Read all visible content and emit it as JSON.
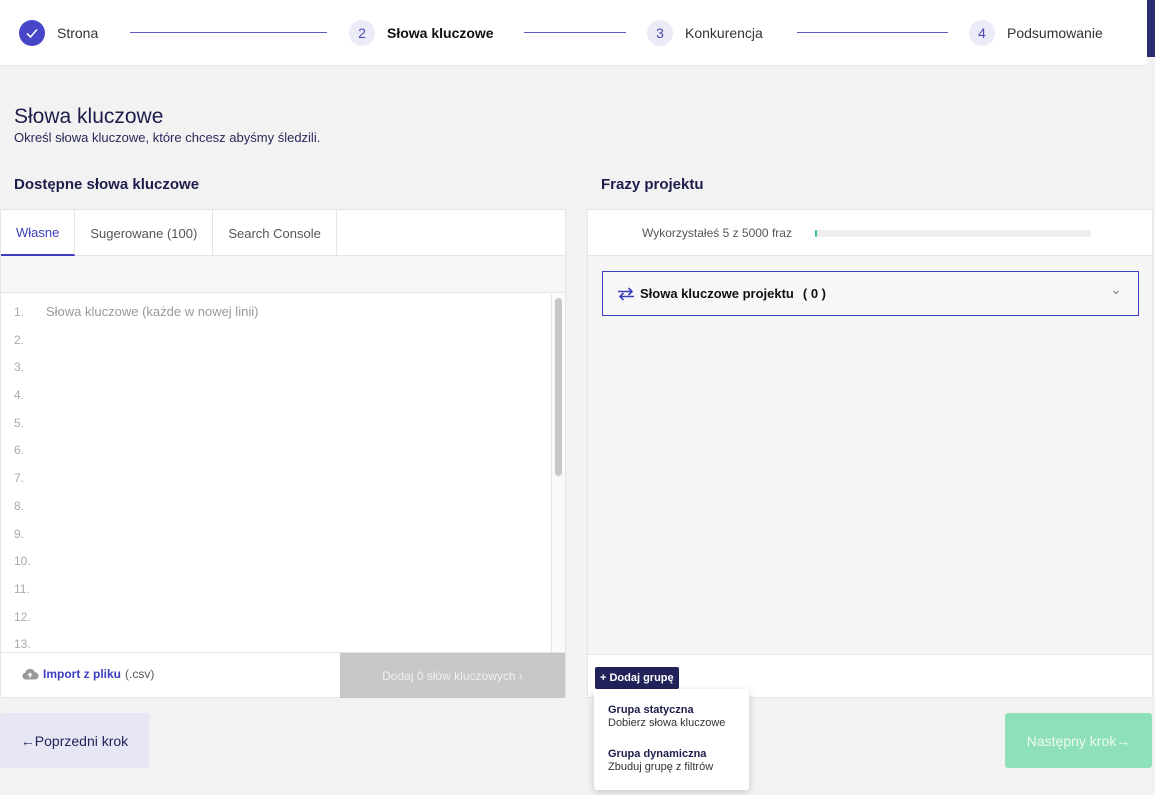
{
  "stepper": {
    "steps": [
      {
        "num": "",
        "label": "Strona",
        "state": "done"
      },
      {
        "num": "2",
        "label": "Słowa kluczowe",
        "state": "active"
      },
      {
        "num": "3",
        "label": "Konkurencja",
        "state": "todo"
      },
      {
        "num": "4",
        "label": "Podsumowanie",
        "state": "todo"
      }
    ]
  },
  "header": {
    "title": "Słowa kluczowe",
    "subtitle": "Określ słowa kluczowe, które chcesz abyśmy śledzili."
  },
  "left": {
    "section_title": "Dostępne słowa kluczowe",
    "tabs": [
      "Własne",
      "Sugerowane (100)",
      "Search Console"
    ],
    "placeholder": "Słowa kluczowe (każde w nowej linii)",
    "line_numbers": [
      "1.",
      "2.",
      "3.",
      "4.",
      "5.",
      "6.",
      "7.",
      "8.",
      "9.",
      "10.",
      "11.",
      "12.",
      "13."
    ],
    "import_link": "Import z pliku",
    "import_ext": "(.csv)",
    "add_button": "Dodaj 0 słów kluczowych ›"
  },
  "right": {
    "section_title": "Frazy projektu",
    "usage_text": "Wykorzystałeś 5 z 5000 fraz",
    "usage_fraction": 0.001,
    "group_title": "Słowa kluczowe projektu",
    "group_count": "( 0 )",
    "add_group_button": "+ Dodaj grupę",
    "menu": [
      {
        "title": "Grupa statyczna",
        "desc": "Dobierz słowa kluczowe"
      },
      {
        "title": "Grupa dynamiczna",
        "desc": "Zbuduj grupę z filtrów"
      }
    ]
  },
  "nav": {
    "prev": "←Poprzedni krok",
    "next": "Następny krok→"
  },
  "colors": {
    "accent": "#3d3dc0",
    "dark": "#22225a",
    "success": "#3cc28c",
    "next_disabled": "#8ee0bb"
  }
}
